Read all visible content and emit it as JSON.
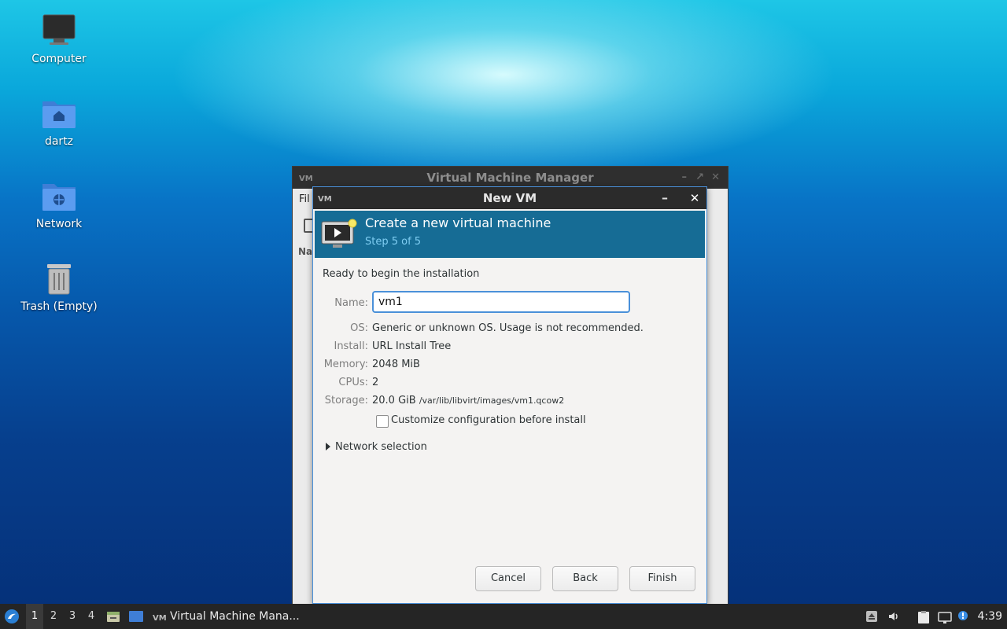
{
  "desktop": {
    "icons": [
      {
        "label": "Computer",
        "icon": "monitor-icon"
      },
      {
        "label": "dartz",
        "icon": "home-folder-icon"
      },
      {
        "label": "Network",
        "icon": "network-folder-icon"
      },
      {
        "label": "Trash (Empty)",
        "icon": "trash-icon"
      }
    ]
  },
  "vmm_window": {
    "title": "Virtual Machine Manager",
    "menu_partial": "Fil",
    "column_partial": "Na"
  },
  "dialog": {
    "title": "New VM",
    "header": "Create a new virtual machine",
    "step": "Step 5 of 5",
    "ready_text": "Ready to begin the installation",
    "name_label": "Name:",
    "name_value": "vm1",
    "os_label": "OS:",
    "os_value": "Generic or unknown OS. Usage is not recommended.",
    "install_label": "Install:",
    "install_value": "URL Install Tree",
    "memory_label": "Memory:",
    "memory_value": "2048 MiB",
    "cpus_label": "CPUs:",
    "cpus_value": "2",
    "storage_label": "Storage:",
    "storage_size": "20.0 GiB",
    "storage_path": "/var/lib/libvirt/images/vm1.qcow2",
    "customize_label": "Customize configuration before install",
    "customize_checked": false,
    "network_label": "Network selection",
    "buttons": {
      "cancel": "Cancel",
      "back": "Back",
      "finish": "Finish"
    }
  },
  "taskbar": {
    "workspaces": [
      "1",
      "2",
      "3",
      "4"
    ],
    "active_workspace": "1",
    "task_label": "Virtual Machine Mana...",
    "clock": "4:39"
  },
  "colors": {
    "banner": "#166c95",
    "focus": "#4a90d9",
    "taskbar": "#252525"
  }
}
